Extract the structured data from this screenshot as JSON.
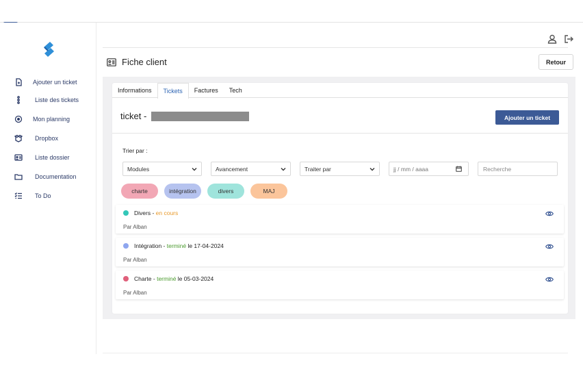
{
  "sidebar": {
    "items": [
      {
        "label": "Ajouter un ticket",
        "icon": "file-plus-icon"
      },
      {
        "label": "Liste des tickets",
        "icon": "list-dots-icon"
      },
      {
        "label": "Mon planning",
        "icon": "target-icon"
      },
      {
        "label": "Dropbox",
        "icon": "dropbox-icon"
      },
      {
        "label": "Liste dossier",
        "icon": "id-card-icon"
      },
      {
        "label": "Documentation",
        "icon": "folder-icon"
      },
      {
        "label": "To Do",
        "icon": "checklist-icon"
      }
    ]
  },
  "header": {
    "title": "Fiche client",
    "back_label": "Retour"
  },
  "tabs": [
    {
      "label": "Informations",
      "active": false
    },
    {
      "label": "Tickets",
      "active": true
    },
    {
      "label": "Factures",
      "active": false
    },
    {
      "label": "Tech",
      "active": false
    }
  ],
  "tickets_panel": {
    "title": "ticket -",
    "add_label": "Ajouter un ticket",
    "sort_label": "Trier par :",
    "filters": {
      "modules": "Modules",
      "avancement": "Avancement",
      "traiter_par": "Traiter par",
      "date_placeholder": "jj / mm / aaaa",
      "search_placeholder": "Recherche"
    },
    "chips": [
      {
        "label": "charte",
        "color": "#f2a7b5"
      },
      {
        "label": "intégration",
        "color": "#b6c3ef"
      },
      {
        "label": "divers",
        "color": "#9fe4dc"
      },
      {
        "label": "MAJ",
        "color": "#fbc59b"
      }
    ],
    "tickets": [
      {
        "category": "Divers",
        "sep": " - ",
        "status": "en cours",
        "status_color": "#e89a2b",
        "date_text": "",
        "author": "Par Alban",
        "dot_color": "#33c7b8"
      },
      {
        "category": "Intégration",
        "sep": " - ",
        "status": "terminé",
        "status_color": "#4a9a2d",
        "date_text": " le 17-04-2024",
        "author": "Par Alban",
        "dot_color": "#8ea6ef"
      },
      {
        "category": "Charte",
        "sep": " - ",
        "status": "terminé",
        "status_color": "#4a9a2d",
        "date_text": " le 05-03-2024",
        "author": "Par Alban",
        "dot_color": "#e0607b"
      }
    ]
  },
  "colors": {
    "primary": "#3c5a96",
    "active_tab": "#2d64b3"
  }
}
